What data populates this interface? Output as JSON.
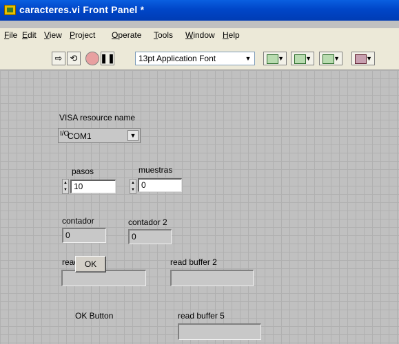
{
  "window": {
    "title": "caracteres.vi Front Panel *"
  },
  "menu": [
    {
      "pre": "",
      "ul": "F",
      "post": "ile"
    },
    {
      "pre": "",
      "ul": "E",
      "post": "dit"
    },
    {
      "pre": "",
      "ul": "V",
      "post": "iew"
    },
    {
      "pre": "",
      "ul": "P",
      "post": "roject"
    },
    {
      "pre": "",
      "ul": "O",
      "post": "perate"
    },
    {
      "pre": "",
      "ul": "T",
      "post": "ools"
    },
    {
      "pre": "",
      "ul": "W",
      "post": "indow"
    },
    {
      "pre": "",
      "ul": "H",
      "post": "elp"
    }
  ],
  "toolbar": {
    "font": "13pt Application Font",
    "icons": [
      "run-arrow-icon",
      "run-continuous-icon",
      "abort-icon",
      "pause-icon",
      "align-icon",
      "distribute-icon",
      "resize-icon",
      "reorder-icon"
    ]
  },
  "panel": {
    "visa": {
      "label": "VISA resource name",
      "value": "COM1",
      "glyph": "I/O"
    },
    "pasos": {
      "label": "pasos",
      "value": "10"
    },
    "muestras": {
      "label": "muestras",
      "value": "0"
    },
    "contador": {
      "label": "contador",
      "value": "0"
    },
    "contador2": {
      "label": "contador 2",
      "value": "0"
    },
    "read_buffer": {
      "label": "read buffer",
      "value": ""
    },
    "read_buffer2": {
      "label": "read buffer 2",
      "value": ""
    },
    "ok": {
      "label": "OK Button",
      "button_text": "OK"
    },
    "read_buffer5": {
      "label": "read buffer 5",
      "value": ""
    }
  },
  "colors": {
    "titlebar": "#0046c8",
    "panel": "#c0c0c0",
    "grid": "#b0b0b0"
  }
}
